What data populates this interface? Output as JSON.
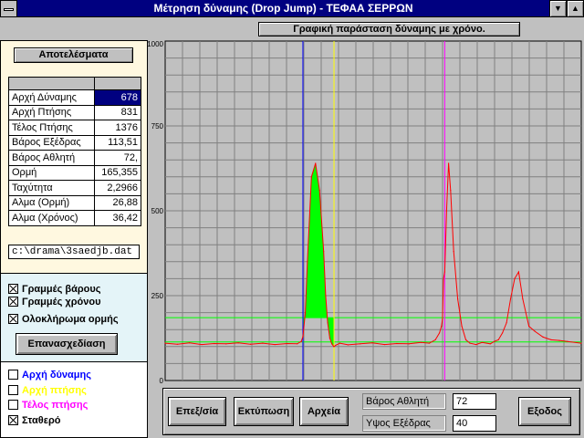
{
  "window": {
    "title": "Μέτρηση δύναμης (Drop Jump) - ΤΕΦΑΑ ΣΕΡΡΩΝ",
    "min_glyph": "▼",
    "max_glyph": "▲"
  },
  "results": {
    "title": "Αποτελέσματα",
    "rows": [
      {
        "label": "Αρχή Δύναμης",
        "value": "678"
      },
      {
        "label": "Αρχή Πτήσης",
        "value": "831"
      },
      {
        "label": "Τέλος Πτήσης",
        "value": "1376"
      },
      {
        "label": "Βάρος Εξέδρας",
        "value": "113,51"
      },
      {
        "label": "Βάρος Αθλητή",
        "value": "72,"
      },
      {
        "label": "Ορμή",
        "value": "165,355"
      },
      {
        "label": "Ταχύτητα",
        "value": "2,2966"
      },
      {
        "label": "Αλμα (Ορμή)",
        "value": "26,88"
      },
      {
        "label": "Αλμα (Χρόνος)",
        "value": "36,42"
      }
    ]
  },
  "file_path": "c:\\drama\\3saedjb.dat",
  "options": {
    "weight_lines": "Γραμμές βάρους",
    "time_lines": "Γραμμές χρόνου",
    "impulse_integral": "Ολοκλήρωμα ορμής",
    "redraw_button": "Επανασχεδίαση"
  },
  "legend": {
    "force_start": {
      "label": "Αρχή δύναμης",
      "color": "#0000ff"
    },
    "flight_start": {
      "label": "Αρχή πτήσης",
      "color": "#ffff00"
    },
    "flight_end": {
      "label": "Τέλος πτήσης",
      "color": "#ff00ff"
    },
    "constant": {
      "label": "Σταθερό",
      "color": "#000000"
    }
  },
  "chart_title": "Γραφική παράσταση δύναμης με χρόνο.",
  "chart_data": {
    "type": "line",
    "title": "Γραφική παράσταση δύναμης με χρόνο.",
    "xlabel": "",
    "ylabel": "",
    "ylim": [
      0,
      1000
    ],
    "xlim": [
      0,
      2048
    ],
    "yticks": [
      0,
      250,
      500,
      750,
      1000
    ],
    "grid": true,
    "background": "#c0c0c0",
    "grid_color": "#808080",
    "series_color": "#ff0000",
    "fill_color": "#00ff00",
    "x": [
      0,
      60,
      120,
      180,
      240,
      300,
      360,
      420,
      480,
      540,
      600,
      650,
      670,
      678,
      690,
      700,
      720,
      740,
      760,
      780,
      790,
      800,
      810,
      820,
      830,
      831,
      840,
      860,
      900,
      960,
      1020,
      1080,
      1140,
      1200,
      1260,
      1300,
      1330,
      1350,
      1360,
      1365,
      1370,
      1376,
      1385,
      1395,
      1405,
      1420,
      1440,
      1460,
      1480,
      1500,
      1530,
      1560,
      1600,
      1620,
      1640,
      1660,
      1680,
      1700,
      1720,
      1740,
      1760,
      1790,
      1820,
      1860,
      1900,
      1940,
      1980,
      2048
    ],
    "y": [
      110,
      107,
      111,
      106,
      109,
      108,
      111,
      107,
      110,
      106,
      109,
      108,
      115,
      130,
      200,
      350,
      600,
      640,
      560,
      380,
      250,
      170,
      125,
      108,
      100,
      100,
      104,
      110,
      105,
      108,
      111,
      106,
      109,
      108,
      112,
      110,
      120,
      140,
      160,
      180,
      300,
      320,
      500,
      640,
      560,
      380,
      240,
      160,
      120,
      110,
      106,
      112,
      108,
      115,
      120,
      140,
      170,
      240,
      300,
      320,
      240,
      160,
      145,
      128,
      120,
      118,
      115,
      110
    ],
    "fill_range": [
      678,
      831
    ],
    "markers": [
      {
        "name": "force-start-marker",
        "x": 678,
        "color": "#0000ff"
      },
      {
        "name": "flight-start-marker",
        "x": 831,
        "color": "#ffff00"
      },
      {
        "name": "flight-end-marker",
        "x": 1376,
        "color": "#ff00ff"
      }
    ],
    "hlines": [
      {
        "name": "athlete-weight-line",
        "y": 185,
        "color": "#00ff00"
      },
      {
        "name": "platform-weight-line",
        "y": 113.51,
        "color": "#00ff00"
      }
    ]
  },
  "toolbar": {
    "process_button": "Επεξ/σία",
    "print_button": "Εκτύπωση",
    "files_button": "Αρχεία",
    "athlete_weight_label": "Βάρος Αθλητή",
    "athlete_weight_value": "72",
    "platform_height_label": "Υψος Εξέδρας",
    "platform_height_value": "40",
    "exit_button": "Εξοδος"
  }
}
